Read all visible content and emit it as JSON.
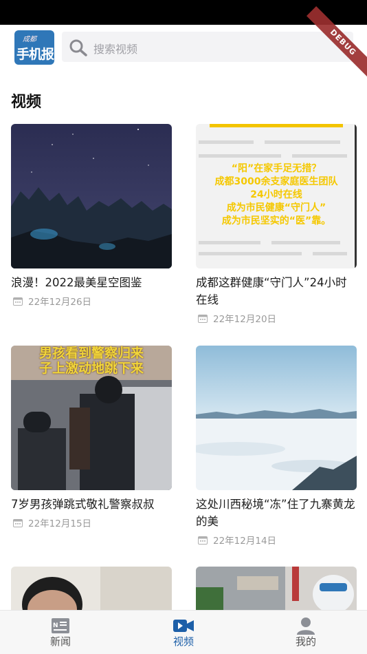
{
  "header": {
    "logo": {
      "small_text": "成都",
      "main_text": "手机报"
    },
    "search": {
      "placeholder": "搜索视频"
    },
    "debug_banner": "DEBUG"
  },
  "section": {
    "title": "视频"
  },
  "videos": [
    {
      "title": "浪漫！2022最美星空图鉴",
      "date": "22年12月26日",
      "thumbnail_text": []
    },
    {
      "title": "成都这群健康“守门人”24小时在线",
      "date": "22年12月20日",
      "thumbnail_text": [
        "“阳”在家手足无措？",
        "成都3000余支家庭医生团队",
        "24小时在线",
        "成为市民健康“守门人”",
        "成为市民坚实的“医”靠。"
      ]
    },
    {
      "title": "7岁男孩弹跳式敬礼警察叔叔",
      "date": "22年12月15日",
      "thumbnail_text": [
        "男孩看到警察归来",
        "子上激动地跳下来"
      ]
    },
    {
      "title": "这处川西秘境“冻”住了九寨黄龙的美",
      "date": "22年12月14日",
      "thumbnail_text": []
    }
  ],
  "tabbar": {
    "tabs": [
      {
        "label": "新闻",
        "icon": "news-icon",
        "active": false
      },
      {
        "label": "视频",
        "icon": "video-camera-icon",
        "active": true
      },
      {
        "label": "我的",
        "icon": "person-icon",
        "active": false
      }
    ]
  },
  "colors": {
    "accent": "#1d5fa8",
    "logo_bg": "#2f77b8",
    "debug_ribbon": "#9c2f2f"
  }
}
